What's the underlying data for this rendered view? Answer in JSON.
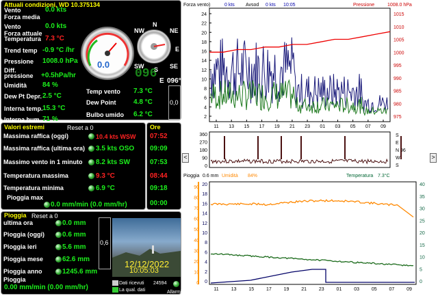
{
  "left": {
    "cond_title": "Attuali condizioni, WD 10.375134",
    "cond_rows": [
      {
        "label": "Vento",
        "value": "0.0 kts"
      },
      {
        "label": "Forza media",
        "value": ""
      },
      {
        "label": "Vento",
        "value": "0.0 kts"
      },
      {
        "label": "Forza attuale",
        "value": ""
      },
      {
        "label": "Temperatura",
        "value": "7.3 °C"
      },
      {
        "label": "Trend temp",
        "value": "-0.9 °C /hr"
      },
      {
        "label": "Pressione",
        "value": "1008.0 hPa"
      },
      {
        "label": "Diff.",
        "value": ""
      },
      {
        "label": "pressione",
        "value": "+0.5hPa/hr"
      },
      {
        "label": "Umidità",
        "value": "84 %"
      },
      {
        "label": "Dew Pt Depr.",
        "value": "2.5 °C"
      },
      {
        "label": "Interna temp.",
        "value": "15.3 °C"
      },
      {
        "label": "Interna hum",
        "value": "71 %"
      }
    ],
    "right_rows": [
      {
        "label": "Temp vento",
        "value": "7.3 °C"
      },
      {
        "label": "Dew Point",
        "value": "4.8 °C"
      },
      {
        "label": "Bulbo umido",
        "value": "6.2 °C"
      }
    ],
    "gauge_value": "0.0",
    "gauge_ticks": [
      "12",
      "16",
      "20",
      "24",
      "28",
      "32",
      "36",
      "40",
      "44",
      "48",
      "50",
      "52",
      "54"
    ],
    "compass": {
      "N": "N",
      "NE": "NE",
      "E": "E",
      "SE": "SE",
      "S": "S",
      "SW": "SW",
      "W": "W",
      "NW": "NW",
      "digital": "096",
      "dir_label": "E",
      "degree": "°",
      "knob": "0,0"
    },
    "extremes_title": "Valori estremi",
    "extremes_reset": "Reset a 0",
    "ore_title": "Ore",
    "extremes": [
      {
        "label": "Massima raffica (oggi)",
        "value": "10.4 kts WSW",
        "time": "07:52",
        "red": true
      },
      {
        "label": "Massima raffica (ultima ora)",
        "value": "3.5 kts OSO",
        "time": "09:09",
        "red": false
      },
      {
        "label": "Massimo vento in 1 minuto",
        "value": "8.2 kts SW",
        "time": "07:53",
        "red": false
      },
      {
        "label": "Temperatura massima",
        "value": "9.3 °C",
        "time": "08:44",
        "red": true
      },
      {
        "label": "Temperatura minima",
        "value": "6.9 °C",
        "time": "09:18",
        "red": false
      },
      {
        "label": "Pioggia max",
        "value": "0.0 mm/min (0.0 mm/hr)",
        "time": "00:00",
        "red": false
      }
    ],
    "rain_title": "Pioggia",
    "rain_reset": "Reset a 0",
    "rain": [
      {
        "label": "ultima ora",
        "value": "0.0 mm"
      },
      {
        "label": "Pioggia (oggi)",
        "value": "0.6 mm"
      },
      {
        "label": "Pioggia ieri",
        "value": "5.6 mm"
      },
      {
        "label": "Pioggia mese",
        "value": "62.6 mm"
      },
      {
        "label": "Pioggia anno",
        "value": "1245.6 mm"
      },
      {
        "label": "Pioggia",
        "value": ""
      }
    ],
    "rain_extra": "0.00 mm/min (0.00 mm/hr)",
    "rain_knob": "0,6",
    "webcam_date": "12/12/2022",
    "webcam_time": "10:05:03",
    "data_ricevuti": "Dati ricevuti",
    "data_count": "24594",
    "qual": "La qual. dati",
    "allarmi": "Allarmi"
  },
  "chart_data": [
    {
      "type": "line",
      "title": "",
      "legend": [
        "Forza vento)",
        "0 kts",
        "Avsod",
        "0 kts",
        "10:05",
        "Pressione",
        "1008.0 hPa"
      ],
      "x_ticks": [
        "11",
        "13",
        "15",
        "17",
        "19",
        "21",
        "23",
        "01",
        "03",
        "05",
        "07",
        "09"
      ],
      "y_left": [
        24,
        22,
        20,
        18,
        16,
        14,
        12,
        10,
        8,
        6,
        4,
        2
      ],
      "y_right": [
        1015,
        1010,
        1005,
        1000,
        995,
        990,
        985,
        980,
        975
      ],
      "series": [
        {
          "name": "Pressione",
          "values": [
            1000,
            1000,
            1001,
            1001,
            1002,
            1002,
            1003,
            1003,
            1004,
            1005,
            1005,
            1006,
            1007,
            1008
          ]
        }
      ]
    },
    {
      "type": "line",
      "title": "",
      "y_left": [
        360,
        270,
        180,
        90,
        0
      ],
      "letters": [
        "S",
        "E",
        "N",
        "W",
        "S"
      ],
      "value_label": "96"
    },
    {
      "type": "line",
      "title": "",
      "legend": [
        "Pioggia",
        "0.6 mm",
        "Umidità",
        "84%",
        "Temperatura",
        "7.3°C"
      ],
      "x_ticks": [
        "11",
        "13",
        "15",
        "17",
        "19",
        "21",
        "23",
        "01",
        "03",
        "05",
        "07",
        "09"
      ],
      "y_left": [
        20,
        18,
        16,
        14,
        12,
        10,
        8,
        6,
        4,
        2,
        0
      ],
      "y_right": [
        40,
        35,
        30,
        25,
        20,
        15,
        10,
        5,
        0
      ],
      "y_far": [
        90,
        80,
        70,
        60,
        50,
        40,
        30,
        20,
        10,
        0
      ]
    }
  ],
  "nav": {
    "left_arrow": "<",
    "right_arrow": ">"
  }
}
